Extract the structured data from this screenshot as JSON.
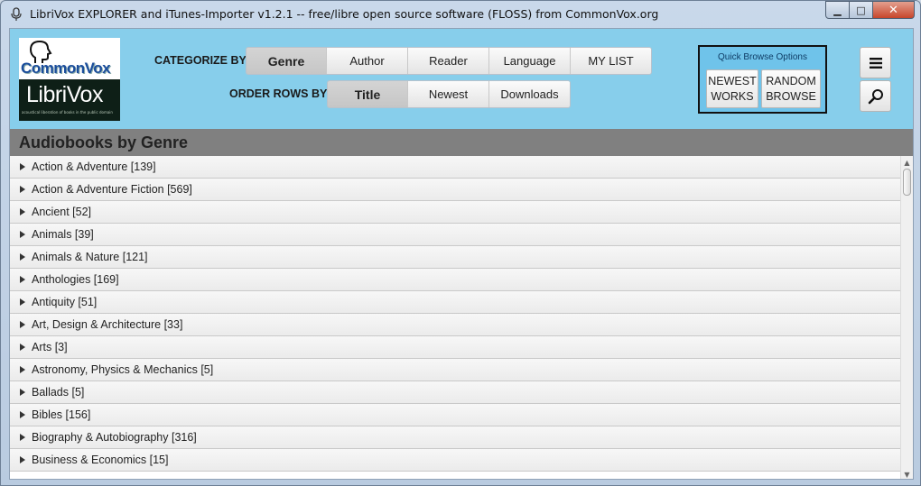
{
  "window": {
    "title": "LibriVox EXPLORER and iTunes-Importer v1.2.1 -- free/libre open source software (FLOSS) from CommonVox.org",
    "minimize_glyph": "▁",
    "maximize_glyph": "□",
    "close_glyph": "✕"
  },
  "logo": {
    "top_text": "CommonVox",
    "bottom_text": "LibriVox",
    "tagline": "acoustical liberation of books in the public domain"
  },
  "categorize": {
    "label": "CATEGORIZE BY",
    "options": [
      "Genre",
      "Author",
      "Reader",
      "Language",
      "MY LIST"
    ],
    "selected": "Genre"
  },
  "order": {
    "label": "ORDER ROWS BY",
    "options": [
      "Title",
      "Newest",
      "Downloads"
    ],
    "selected": "Title"
  },
  "quick_browse": {
    "title": "Quick Browse Options",
    "newest_line1": "NEWEST",
    "newest_line2": "WORKS",
    "random_line1": "RANDOM",
    "random_line2": "BROWSE"
  },
  "side_buttons": {
    "menu_icon": "hamburger-menu-icon",
    "search_icon": "magnifier-search-icon"
  },
  "section": {
    "title": "Audiobooks by Genre"
  },
  "genres": [
    "Action & Adventure [139]",
    "Action & Adventure Fiction [569]",
    "Ancient [52]",
    "Animals [39]",
    "Animals & Nature [121]",
    "Anthologies [169]",
    "Antiquity [51]",
    "Art, Design & Architecture [33]",
    "Arts [3]",
    "Astronomy, Physics & Mechanics [5]",
    "Ballads [5]",
    "Bibles [156]",
    "Biography & Autobiography [316]",
    "Business & Economics [15]"
  ],
  "scrollbar": {
    "up_glyph": "▲",
    "down_glyph": "▼"
  },
  "colors": {
    "header_bg": "#87ceeb",
    "section_bg": "#808080",
    "quick_bg": "#6fc3ea"
  }
}
